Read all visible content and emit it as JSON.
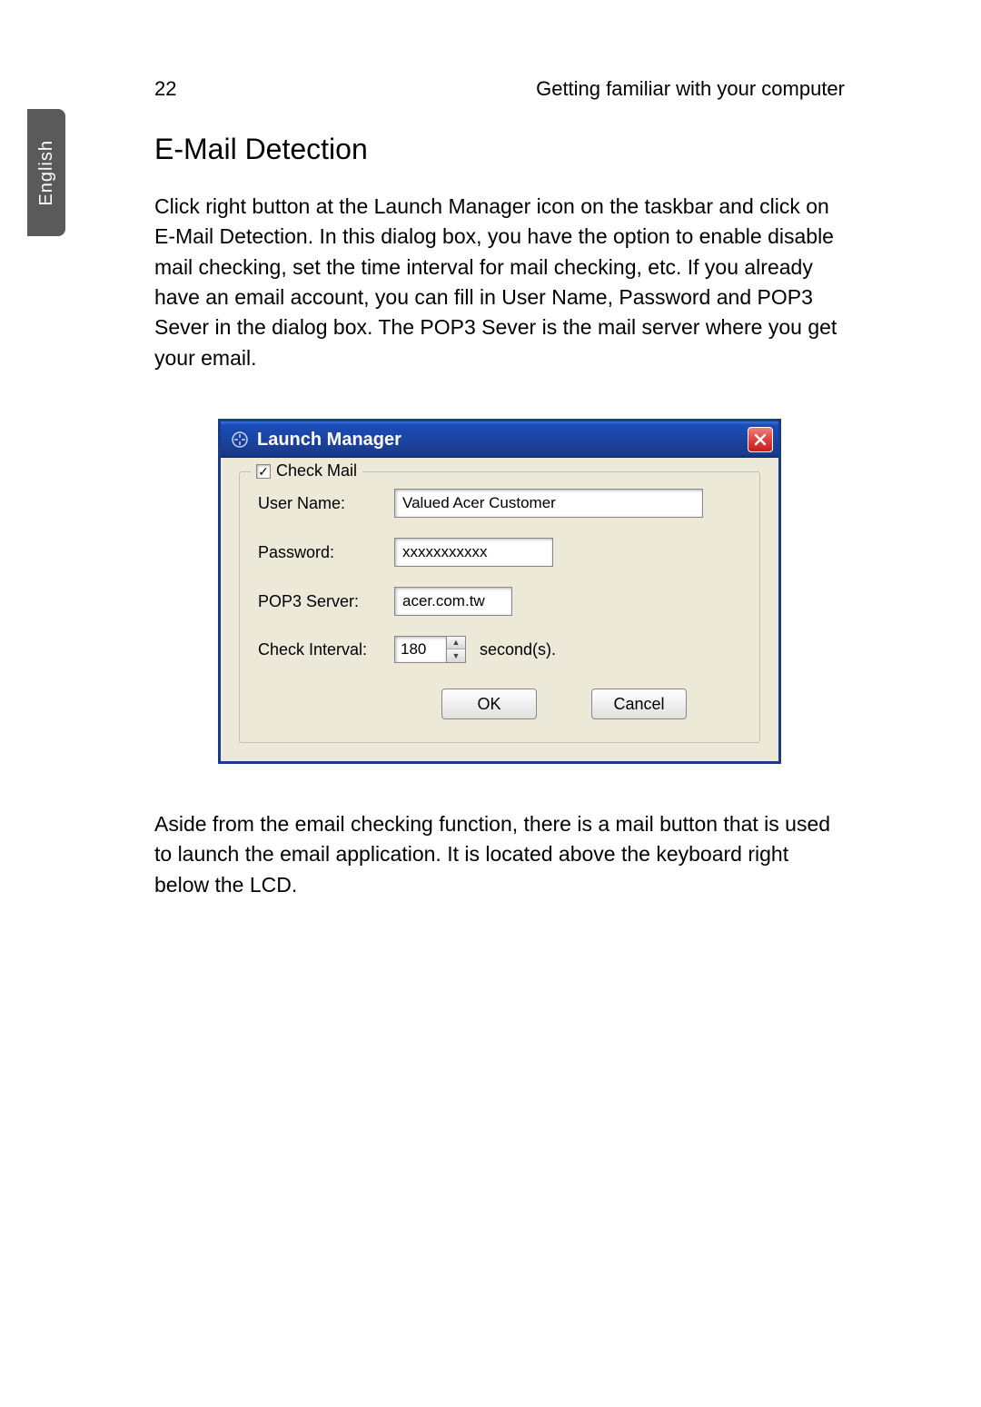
{
  "page": {
    "number": "22",
    "header": "Getting familiar with your  computer",
    "tab_label": "English"
  },
  "section": {
    "heading": "E-Mail Detection",
    "paragraph1": "Click right button at the Launch Manager icon on the taskbar and click on E-Mail Detection. In this dialog box, you have the option to enable disable mail checking, set the time interval for mail checking, etc. If you already have an email account, you can fill in User Name, Password and POP3 Sever in the dialog box. The POP3 Sever is the mail server where you get your email.",
    "paragraph2": "Aside from the email checking function, there is a mail button that is used to launch the email application. It is located above the keyboard right below the LCD."
  },
  "dialog": {
    "title": "Launch Manager",
    "checkbox_label": "Check Mail",
    "checkbox_checked": "✓",
    "fields": {
      "username_label": "User Name:",
      "username_value": "Valued Acer Customer",
      "password_label": "Password:",
      "password_value": "xxxxxxxxxxx",
      "pop3_label": "POP3 Server:",
      "pop3_value": "acer.com.tw",
      "interval_label": "Check Interval:",
      "interval_value": "180",
      "interval_unit": "second(s)."
    },
    "buttons": {
      "ok": "OK",
      "cancel": "Cancel"
    }
  }
}
